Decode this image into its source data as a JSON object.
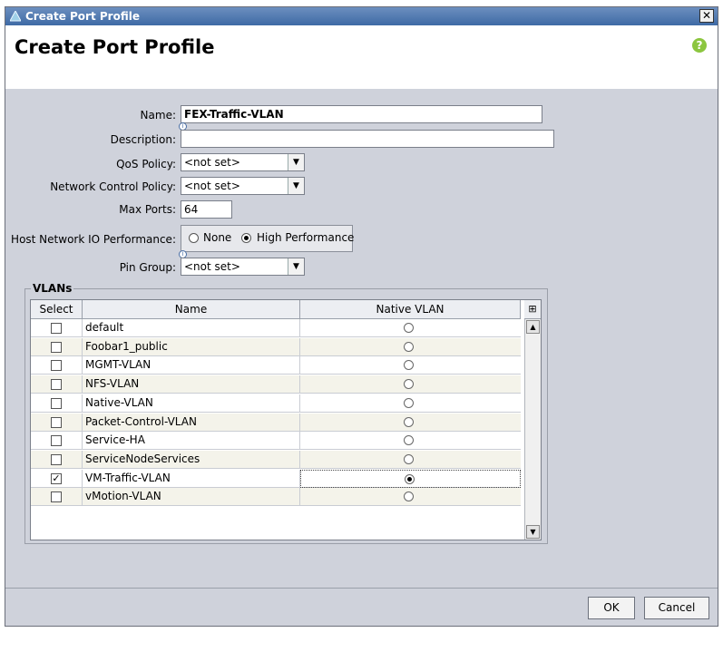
{
  "window": {
    "title": "Create Port Profile"
  },
  "header": {
    "title": "Create Port Profile",
    "help_icon": "help-icon"
  },
  "form": {
    "name_label": "Name:",
    "name_value": "FEX-Traffic-VLAN",
    "description_label": "Description:",
    "description_value": "",
    "qos_label": "QoS Policy:",
    "qos_value": "<not set>",
    "ncp_label": "Network Control Policy:",
    "ncp_value": "<not set>",
    "maxports_label": "Max Ports:",
    "maxports_value": "64",
    "hostio_label": "Host Network IO Performance:",
    "hostio_options": [
      "None",
      "High Performance"
    ],
    "hostio_selected": "High Performance",
    "pingroup_label": "Pin Group:",
    "pingroup_value": "<not set>"
  },
  "vlans": {
    "legend": "VLANs",
    "columns": [
      "Select",
      "Name",
      "Native VLAN"
    ],
    "rows": [
      {
        "name": "default",
        "selected": false,
        "native": false
      },
      {
        "name": "Foobar1_public",
        "selected": false,
        "native": false
      },
      {
        "name": "MGMT-VLAN",
        "selected": false,
        "native": false
      },
      {
        "name": "NFS-VLAN",
        "selected": false,
        "native": false
      },
      {
        "name": "Native-VLAN",
        "selected": false,
        "native": false
      },
      {
        "name": "Packet-Control-VLAN",
        "selected": false,
        "native": false
      },
      {
        "name": "Service-HA",
        "selected": false,
        "native": false
      },
      {
        "name": "ServiceNodeServices",
        "selected": false,
        "native": false
      },
      {
        "name": "VM-Traffic-VLAN",
        "selected": true,
        "native": true
      },
      {
        "name": "vMotion-VLAN",
        "selected": false,
        "native": false
      }
    ]
  },
  "footer": {
    "ok_label": "OK",
    "cancel_label": "Cancel"
  },
  "colors": {
    "titlebar": "#4a74ad",
    "panel": "#cfd2db",
    "row_alt": "#f4f3ea",
    "help": "#8cc63f"
  }
}
